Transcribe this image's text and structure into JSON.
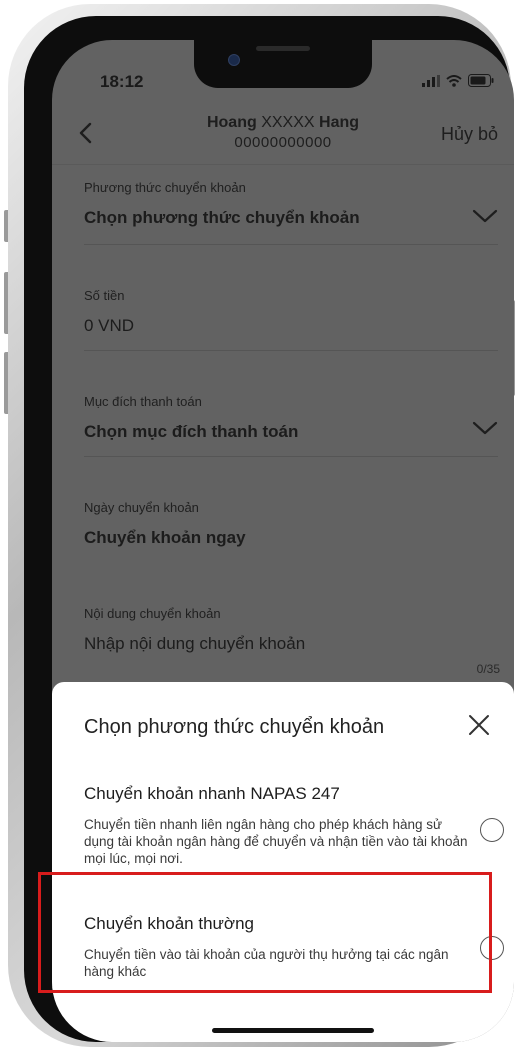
{
  "status_bar": {
    "time": "18:12"
  },
  "header": {
    "name_first": "Hoang",
    "name_masked": "XXXXX",
    "name_last": "Hang",
    "account_number": "00000000000",
    "cancel_label": "Hủy bỏ"
  },
  "form": {
    "method": {
      "label": "Phương thức chuyển khoản",
      "value": "Chọn phương thức chuyển khoản"
    },
    "amount": {
      "label": "Số tiền",
      "value": "0 VND"
    },
    "purpose": {
      "label": "Mục đích thanh toán",
      "value": "Chọn mục đích thanh toán"
    },
    "date": {
      "label": "Ngày chuyển khoản",
      "value": "Chuyển khoản ngay"
    },
    "content": {
      "label": "Nội dung chuyển khoản",
      "placeholder": "Nhập nội dung chuyển khoản",
      "counter": "0/35"
    }
  },
  "sheet": {
    "title": "Chọn phương thức chuyển khoản",
    "options": [
      {
        "title": "Chuyển khoản nhanh NAPAS 247",
        "description": "Chuyển tiền nhanh liên ngân hàng cho phép khách hàng sử dụng tài khoản ngân hàng để chuyển và nhận tiền vào tài khoản mọi lúc, mọi nơi.",
        "selected": false
      },
      {
        "title": "Chuyển khoản thường",
        "description": "Chuyển tiền vào tài khoản của người thụ hưởng tại các ngân hàng khác",
        "selected": false
      }
    ]
  },
  "colors": {
    "highlight": "#d81c1c",
    "overlay": "#626262",
    "sheet": "#ffffff"
  },
  "icons": [
    "back-arrow-icon",
    "chevron-down-icon",
    "close-icon",
    "signal-icon",
    "wifi-icon",
    "battery-icon"
  ]
}
